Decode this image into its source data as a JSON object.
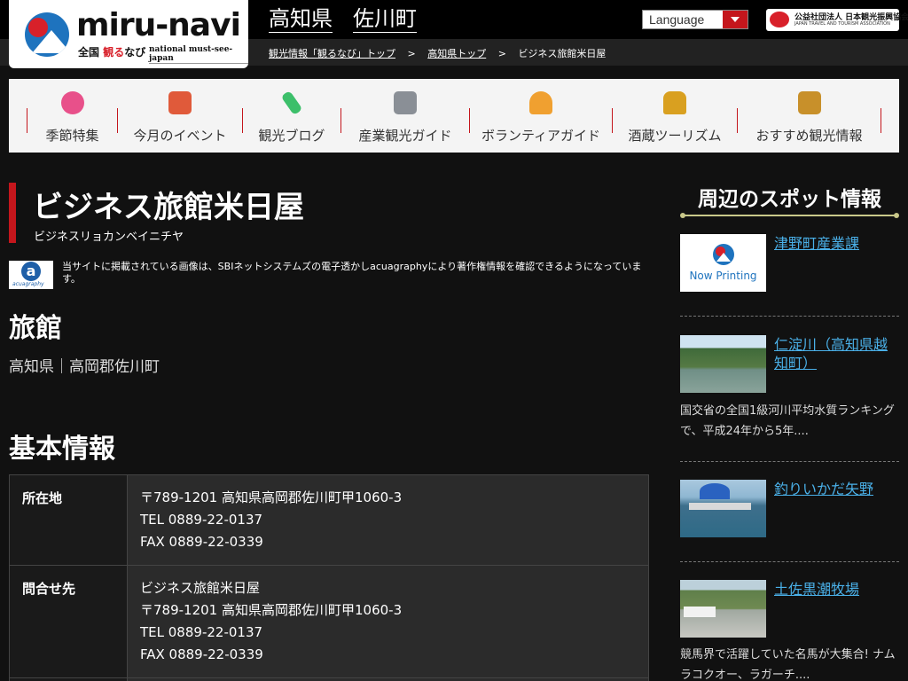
{
  "header": {
    "logo": {
      "brand": "miru-navi",
      "sub_left": "全国",
      "sub_red": "観る",
      "sub_right": "なび",
      "tagline": "national must-see-japan"
    },
    "prefecture_link": "高知県",
    "town_link": "佐川町",
    "language_label": "Language",
    "jnto_line1": "公益社団法人 日本観光振興協会",
    "jnto_line2": "JAPAN TRAVEL AND TOURISM ASSOCIATION"
  },
  "breadcrumb": {
    "items": [
      "観光情報「観るなび」トップ",
      "高知県トップ"
    ],
    "separator": ">",
    "current": "ビジネス旅館米日屋"
  },
  "nav": {
    "items": [
      {
        "label": "季節特集",
        "icon": "cherry-blossom-icon",
        "color": "#e8508a"
      },
      {
        "label": "今月のイベント",
        "icon": "camera-icon",
        "color": "#e05a3a"
      },
      {
        "label": "観光ブログ",
        "icon": "pen-icon",
        "color": "#3cbf6a"
      },
      {
        "label": "産業観光ガイド",
        "icon": "factory-icon",
        "color": "#8a8f96"
      },
      {
        "label": "ボランティアガイド",
        "icon": "guide-person-icon",
        "color": "#f0a030"
      },
      {
        "label": "酒蔵ツーリズム",
        "icon": "sake-icon",
        "color": "#d9a020"
      },
      {
        "label": "おすすめ観光情報",
        "icon": "suitcase-icon",
        "color": "#c8902a"
      }
    ]
  },
  "main": {
    "title": "ビジネス旅館米日屋",
    "kana": "ビジネスリョカンベイニチヤ",
    "acua_logo_text": "acuagraphy",
    "acua_note": "当サイトに掲載されている画像は、SBIネットシステムズの電子透かしacuagraphyにより著作権情報を確認できるようになっています。",
    "category": "旅館",
    "location": "高知県｜高岡郡佐川町",
    "section_heading": "基本情報",
    "info": [
      {
        "label": "所在地",
        "lines": [
          "〒789-1201 高知県高岡郡佐川町甲1060-3",
          "TEL 0889-22-0137",
          "FAX 0889-22-0339"
        ]
      },
      {
        "label": "問合せ先",
        "lines": [
          "ビジネス旅館米日屋",
          "〒789-1201 高知県高岡郡佐川町甲1060-3",
          "TEL 0889-22-0137",
          "FAX 0889-22-0339"
        ]
      }
    ]
  },
  "sidebar": {
    "title": "周辺のスポット情報",
    "spots": [
      {
        "name": "津野町産業課",
        "thumb_text": "Now Printing",
        "desc": ""
      },
      {
        "name": "仁淀川（高知県越知町）",
        "desc": "国交省の全国1級河川平均水質ランキングで、平成24年から5年...."
      },
      {
        "name": "釣りいかだ矢野",
        "desc": ""
      },
      {
        "name": "土佐黒潮牧場",
        "desc": "競馬界で活躍していた名馬が大集合! ナムラコクオー、ラガーチ...."
      }
    ]
  },
  "colors": {
    "accent_red": "#c4161c",
    "link_blue": "#4ab0e8",
    "background": "#111111"
  }
}
